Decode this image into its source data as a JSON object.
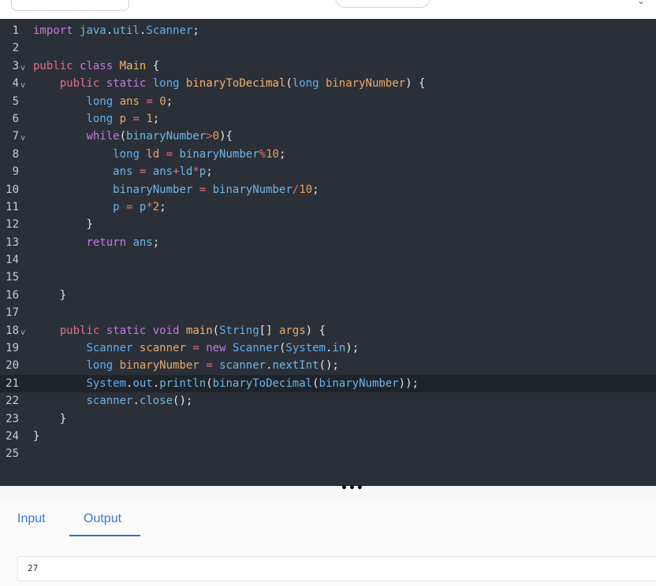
{
  "toolbar": {
    "mid_button_text": "..."
  },
  "code_lines": [
    {
      "n": "1",
      "fold": false,
      "html": "<span class='kw'>import</span> <span class='idf'>java</span><span class='pl'>.</span><span class='idf'>util</span><span class='pl'>.</span><span class='ty'>Scanner</span><span class='pl'>;</span>"
    },
    {
      "n": "2",
      "fold": false,
      "html": ""
    },
    {
      "n": "3",
      "fold": true,
      "html": "<span class='kw2'>public</span> <span class='kw'>class</span> <span class='cls'>Main</span> <span class='pl'>{</span>"
    },
    {
      "n": "4",
      "fold": true,
      "html": "    <span class='kw2'>public</span> <span class='kw'>static</span> <span class='ty'>long</span> <span class='fn'>binaryToDecimal</span><span class='pl'>(</span><span class='ty'>long</span> <span class='vr'>binaryNumber</span><span class='pl'>) {</span>"
    },
    {
      "n": "5",
      "fold": false,
      "html": "        <span class='ty'>long</span> <span class='vr'>ans</span> <span class='op'>=</span> <span class='num'>0</span><span class='pl'>;</span>"
    },
    {
      "n": "6",
      "fold": false,
      "html": "        <span class='ty'>long</span> <span class='vr'>p</span> <span class='op'>=</span> <span class='num'>1</span><span class='pl'>;</span>"
    },
    {
      "n": "7",
      "fold": true,
      "html": "        <span class='kw'>while</span><span class='pl'>(</span><span class='idf'>binaryNumber</span><span class='op'>&gt;</span><span class='num'>0</span><span class='pl'>){</span>"
    },
    {
      "n": "8",
      "fold": false,
      "html": "            <span class='ty'>long</span> <span class='vr'>ld</span> <span class='op'>=</span> <span class='idf'>binaryNumber</span><span class='op'>%</span><span class='num'>10</span><span class='pl'>;</span>"
    },
    {
      "n": "9",
      "fold": false,
      "html": "            <span class='idf'>ans</span> <span class='op'>=</span> <span class='idf'>ans</span><span class='op'>+</span><span class='idf'>ld</span><span class='op'>*</span><span class='idf'>p</span><span class='pl'>;</span>"
    },
    {
      "n": "10",
      "fold": false,
      "html": "            <span class='idf'>binaryNumber</span> <span class='op'>=</span> <span class='idf'>binaryNumber</span><span class='op'>/</span><span class='num'>10</span><span class='pl'>;</span>"
    },
    {
      "n": "11",
      "fold": false,
      "html": "            <span class='idf'>p</span> <span class='op'>=</span> <span class='idf'>p</span><span class='op'>*</span><span class='num'>2</span><span class='pl'>;</span>"
    },
    {
      "n": "12",
      "fold": false,
      "html": "        <span class='pl'>}</span>"
    },
    {
      "n": "13",
      "fold": false,
      "html": "        <span class='kw'>return</span> <span class='idf'>ans</span><span class='pl'>;</span>"
    },
    {
      "n": "14",
      "fold": false,
      "html": ""
    },
    {
      "n": "15",
      "fold": false,
      "html": ""
    },
    {
      "n": "16",
      "fold": false,
      "html": "    <span class='pl'>}</span>"
    },
    {
      "n": "17",
      "fold": false,
      "html": ""
    },
    {
      "n": "18",
      "fold": true,
      "html": "    <span class='kw2'>public</span> <span class='kw'>static</span> <span class='kw'>void</span> <span class='fn'>main</span><span class='pl'>(</span><span class='ty'>String</span><span class='pl'>[]</span> <span class='vr'>args</span><span class='pl'>) {</span>"
    },
    {
      "n": "19",
      "fold": false,
      "html": "        <span class='ty'>Scanner</span> <span class='vr'>scanner</span> <span class='op'>=</span> <span class='kw'>new</span> <span class='ty'>Scanner</span><span class='pl'>(</span><span class='ty'>System</span><span class='pl'>.</span><span class='idf'>in</span><span class='pl'>);</span>"
    },
    {
      "n": "20",
      "fold": false,
      "html": "        <span class='ty'>long</span> <span class='vr'>binaryNumber</span> <span class='op'>=</span> <span class='idf'>scanner</span><span class='pl'>.</span><span class='idf'>nextInt</span><span class='pl'>();</span>"
    },
    {
      "n": "21",
      "fold": false,
      "active": true,
      "html": "        <span class='ty'>System</span><span class='pl'>.</span><span class='idf'>out</span><span class='pl'>.</span><span class='idf'>println</span><span class='pl'>(</span><span class='idf'>binaryToDecimal</span><span class='pl'>(</span><span class='idf'>binaryNumber</span><span class='pl'>));</span>"
    },
    {
      "n": "22",
      "fold": false,
      "html": "        <span class='idf'>scanner</span><span class='pl'>.</span><span class='idf'>close</span><span class='pl'>();</span>"
    },
    {
      "n": "23",
      "fold": false,
      "html": "    <span class='pl'>}</span>"
    },
    {
      "n": "24",
      "fold": false,
      "html": "<span class='pl'>}</span>"
    },
    {
      "n": "25",
      "fold": false,
      "html": ""
    }
  ],
  "fold_glyph": "v",
  "splitter_glyph": "•••",
  "tabs": [
    {
      "id": "input",
      "label": "Input"
    },
    {
      "id": "output",
      "label": "Output",
      "active": true
    }
  ],
  "output_value": "27"
}
